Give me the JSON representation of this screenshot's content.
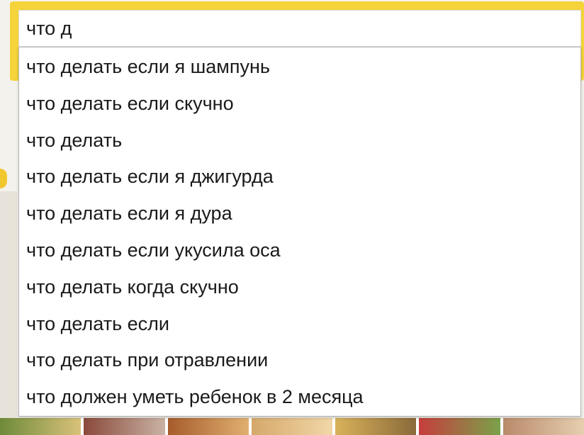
{
  "search": {
    "query": "что д"
  },
  "suggestions": [
    "что делать если я шампунь",
    "что делать если скучно",
    "что делать",
    "что делать если я джигурда",
    "что делать если я дура",
    "что делать если укусила оса",
    "что делать когда скучно",
    "что делать если",
    "что делать при отравлении",
    "что должен уметь ребенок в 2 месяца"
  ],
  "colors": {
    "accent": "#f5d33a",
    "text": "#1a1a1a",
    "dropdown_border": "#b8b8b8"
  }
}
